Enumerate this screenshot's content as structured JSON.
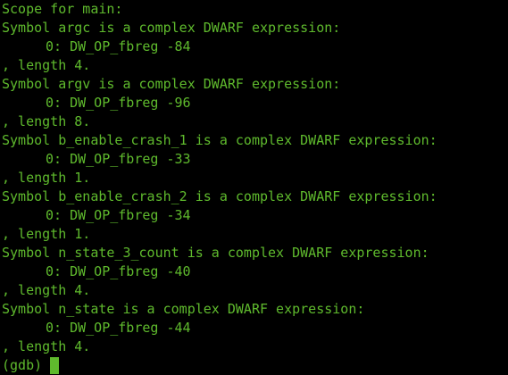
{
  "terminal": {
    "text_color": "#5fba2d",
    "background_color": "#000000",
    "lines": [
      "Scope for main:",
      "Symbol argc is a complex DWARF expression:",
      "0: DW_OP_fbreg -84",
      ", length 4.",
      "Symbol argv is a complex DWARF expression:",
      "0: DW_OP_fbreg -96",
      ", length 8.",
      "Symbol b_enable_crash_1 is a complex DWARF expression:",
      "0: DW_OP_fbreg -33",
      ", length 1.",
      "Symbol b_enable_crash_2 is a complex DWARF expression:",
      "0: DW_OP_fbreg -34",
      ", length 1.",
      "Symbol n_state_3_count is a complex DWARF expression:",
      "0: DW_OP_fbreg -40",
      ", length 4.",
      "Symbol n_state is a complex DWARF expression:",
      "0: DW_OP_fbreg -44",
      ", length 4."
    ],
    "prompt": "(gdb)"
  }
}
